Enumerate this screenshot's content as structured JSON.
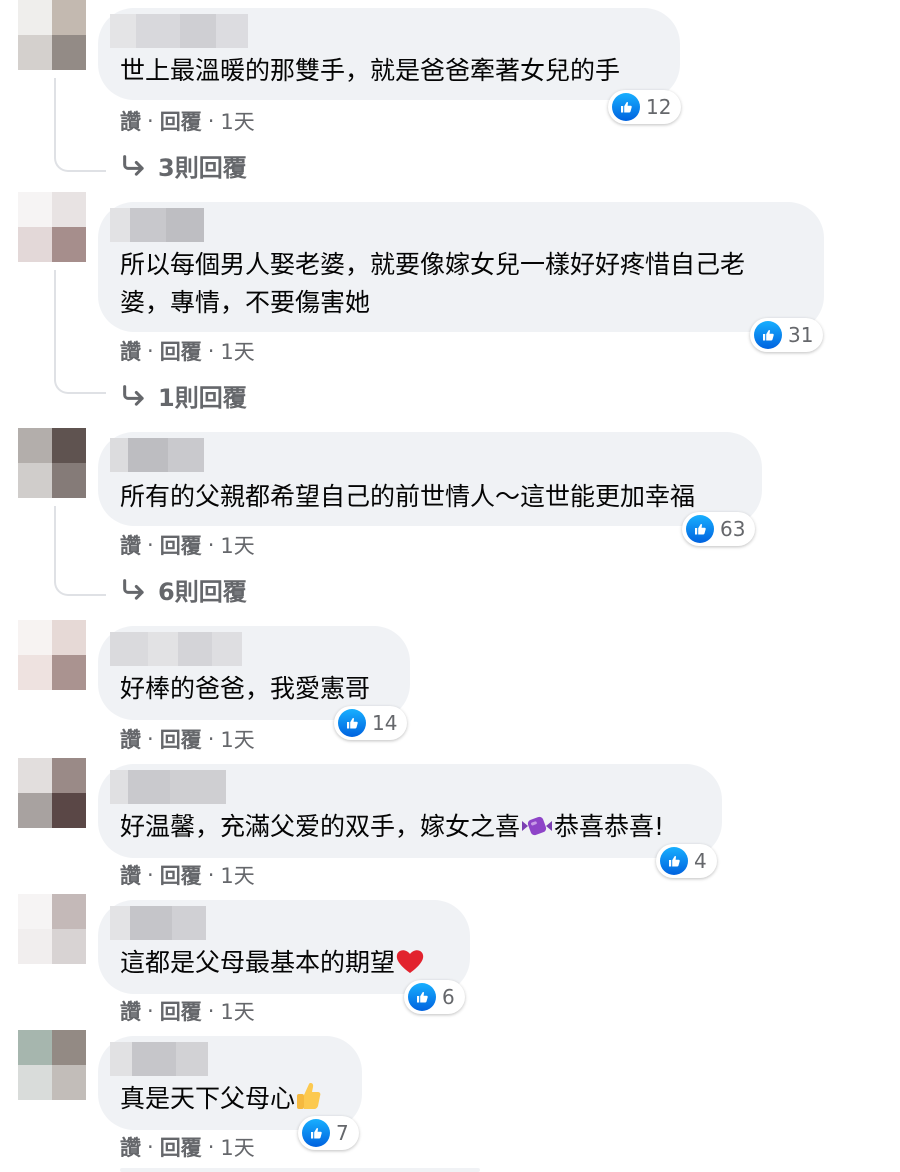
{
  "icons": {
    "like": "like-icon",
    "reply_arrow": "reply-arrow-icon"
  },
  "colors": {
    "bubble": "#f0f2f5",
    "meta_text": "#65676b",
    "like_blue": "#1877f2"
  },
  "actions": {
    "like": "讚",
    "reply": "回覆",
    "separator": "·"
  },
  "comments": [
    {
      "text": "世上最溫暖的那雙手，就是爸爸牽著女兒的手",
      "likes": "12",
      "time": "1天",
      "replies": "3則回覆"
    },
    {
      "text": "所以每個男人娶老婆，就要像嫁女兒一樣好好疼惜自己老\n婆，專情，不要傷害她",
      "likes": "31",
      "time": "1天",
      "replies": "1則回覆"
    },
    {
      "text": "所有的父親都希望自己的前世情人～這世能更加幸福",
      "likes": "63",
      "time": "1天",
      "replies": "6則回覆"
    },
    {
      "text": "好棒的爸爸，我愛憲哥",
      "likes": "14",
      "time": "1天"
    },
    {
      "text": "好温馨，充滿父爱的双手，嫁女之喜",
      "text_after": "恭喜恭喜!",
      "emoji": "purple-candy-emoji",
      "likes": "4",
      "time": "1天"
    },
    {
      "text": "這都是父母最基本的期望",
      "emoji": "red-heart-emoji",
      "likes": "6",
      "time": "1天"
    },
    {
      "text": "真是天下父母心",
      "emoji": "thumbs-up-emoji",
      "likes": "7",
      "time": "1天"
    }
  ]
}
